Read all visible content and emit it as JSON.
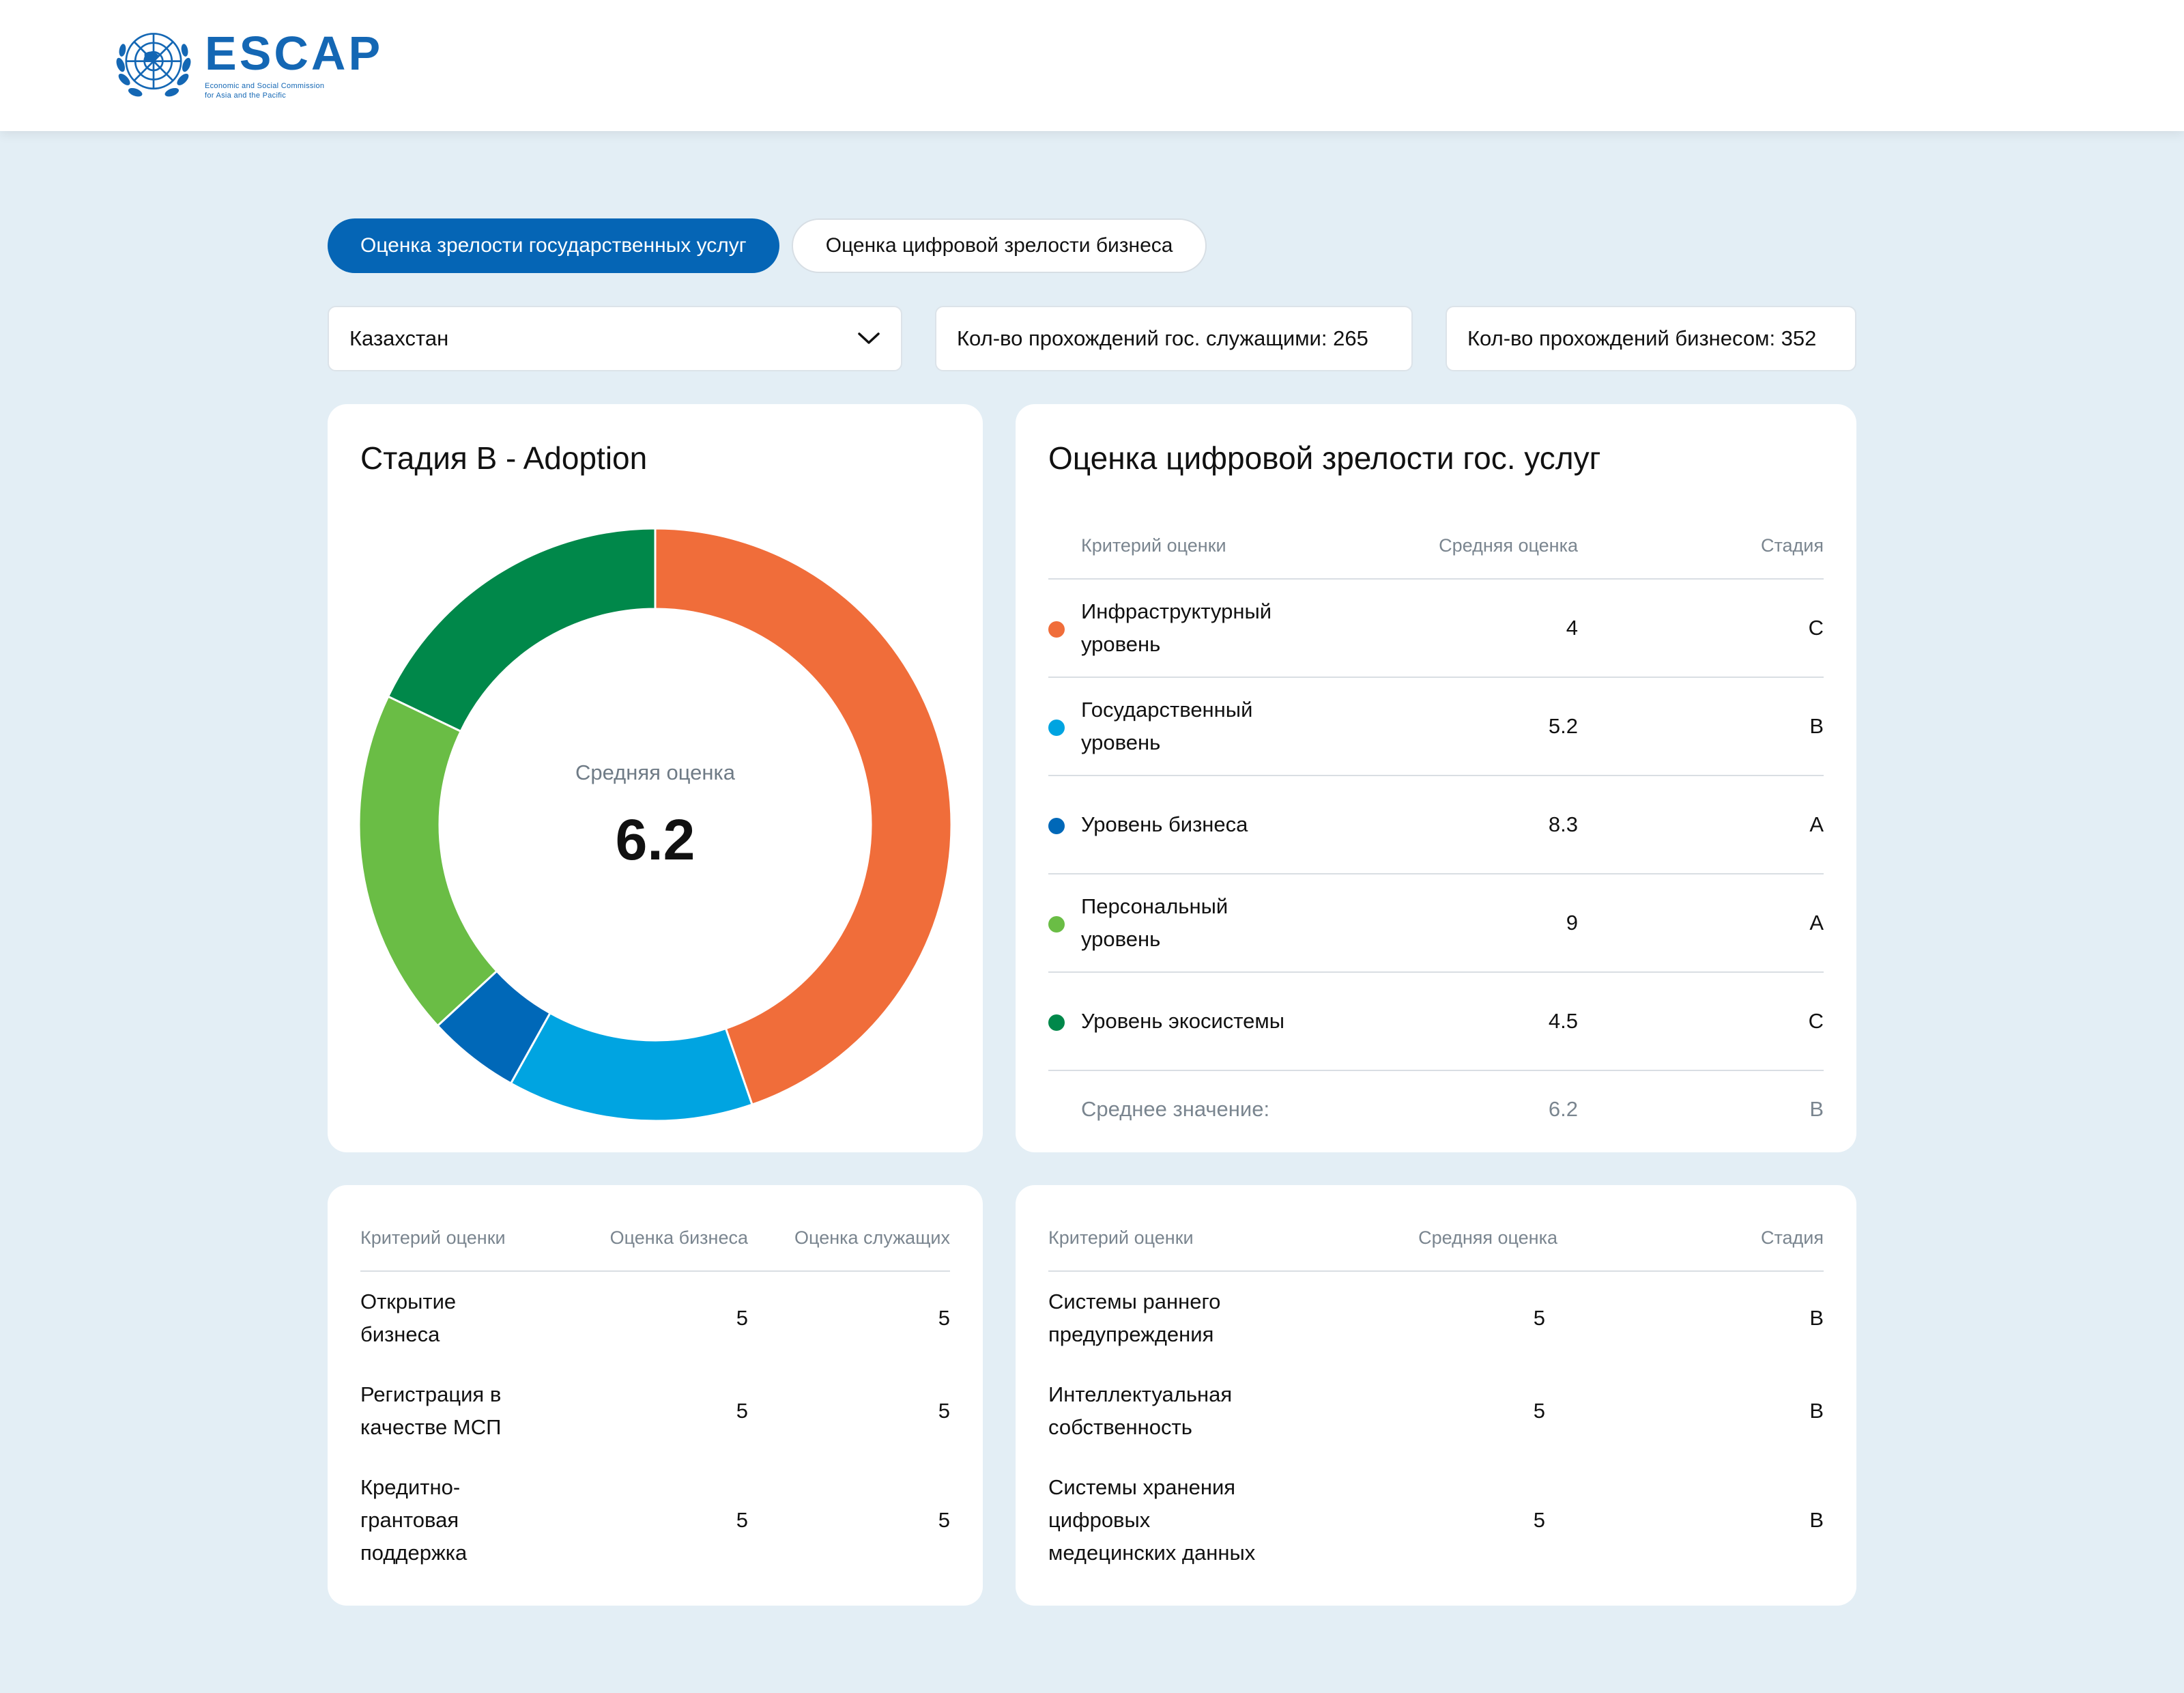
{
  "header": {
    "logo_word": "ESCAP",
    "logo_subtitle_line1": "Economic and Social Commission",
    "logo_subtitle_line2": "for Asia and the Pacific"
  },
  "tabs": [
    {
      "label": "Оценка зрелости государственных услуг",
      "active": true
    },
    {
      "label": "Оценка цифровой зрелости бизнеса",
      "active": false
    }
  ],
  "country_select": {
    "value": "Казахстан"
  },
  "stats": {
    "civil_servants": "Кол-во прохождений гос. служащими: 265",
    "business": "Кол-во прохождений бизнесом: 352"
  },
  "donut_card": {
    "title": "Стадия B - Adoption",
    "center_label": "Средняя оценка",
    "center_value": "6.2"
  },
  "chart_data": {
    "type": "pie",
    "title": "Стадия B - Adoption",
    "series": [
      {
        "value": 4,
        "color": "#F06D3A"
      },
      {
        "value": 1.2,
        "color": "#00A4E1"
      },
      {
        "value": 0.45,
        "color": "#0068B8"
      },
      {
        "value": 1.7,
        "color": "#6ABD45"
      },
      {
        "value": 1.6,
        "color": "#00884A"
      }
    ]
  },
  "main_table": {
    "title": "Оценка цифровой зрелости гос. услуг",
    "headers": [
      "Критерий оценки",
      "Средняя оценка",
      "Стадия"
    ],
    "rows": [
      {
        "label_l1": "Инфраструктурный",
        "label_l2": "уровень",
        "score": "4",
        "stage": "C",
        "color": "#F06D3A"
      },
      {
        "label_l1": "Государственный",
        "label_l2": "уровень",
        "score": "5.2",
        "stage": "B",
        "color": "#00A4E1"
      },
      {
        "label_l1": "Уровень бизнеса",
        "label_l2": "",
        "score": "8.3",
        "stage": "A",
        "color": "#0068B8"
      },
      {
        "label_l1": "Персональный",
        "label_l2": "уровень",
        "score": "9",
        "stage": "A",
        "color": "#6ABD45"
      },
      {
        "label_l1": "Уровень экосистемы",
        "label_l2": "",
        "score": "4.5",
        "stage": "C",
        "color": "#00884A"
      }
    ],
    "average": {
      "label": "Среднее значение:",
      "score": "6.2",
      "stage": "B"
    }
  },
  "bottom_left_table": {
    "headers": [
      "Критерий оценки",
      "Оценка бизнеса",
      "Оценка служащих"
    ],
    "rows": [
      {
        "l1": "Открытие",
        "l2": "бизнеса",
        "l3": "",
        "business": "5",
        "servants": "5"
      },
      {
        "l1": "Регистрация в",
        "l2": "качестве МСП",
        "l3": "",
        "business": "5",
        "servants": "5"
      },
      {
        "l1": "Кредитно-",
        "l2": "грантовая",
        "l3": "поддержка",
        "business": "5",
        "servants": "5"
      }
    ]
  },
  "bottom_right_table": {
    "headers": [
      "Критерий оценки",
      "Средняя оценка",
      "Стадия"
    ],
    "rows": [
      {
        "l1": "Системы раннего",
        "l2": "предупреждения",
        "l3": "",
        "score": "5",
        "stage": "B"
      },
      {
        "l1": "Интеллектуальная",
        "l2": "собственность",
        "l3": "",
        "score": "5",
        "stage": "B"
      },
      {
        "l1": "Системы хранения",
        "l2": "цифровых",
        "l3": "медецинских данных",
        "score": "5",
        "stage": "B"
      }
    ]
  },
  "colors": {
    "accent": "#0565B5",
    "background": "#E3EEF5",
    "logo": "#1467B4"
  },
  "icons": {
    "select_arrow": "chevron-down-icon",
    "logo_emblem": "un-emblem-icon"
  }
}
